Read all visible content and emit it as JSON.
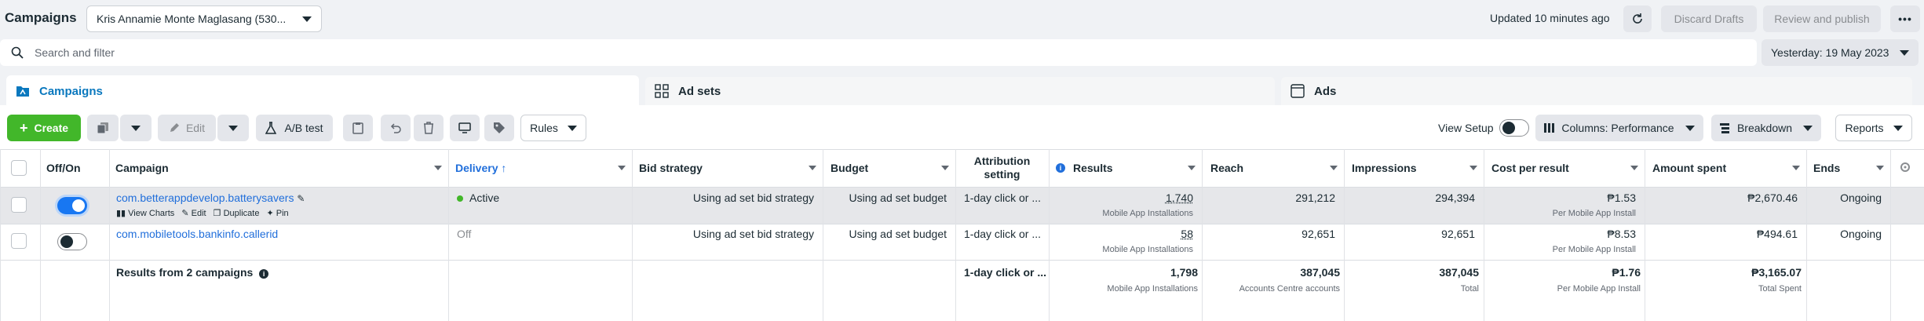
{
  "header": {
    "title": "Campaigns",
    "account": "Kris Annamie Monte Maglasang (530...",
    "updated": "Updated 10 minutes ago",
    "discard_label": "Discard Drafts",
    "review_label": "Review and publish",
    "more_label": "•••"
  },
  "search": {
    "placeholder": "Search and filter"
  },
  "date_range": "Yesterday: 19 May 2023",
  "tabs": {
    "campaigns": "Campaigns",
    "adsets": "Ad sets",
    "ads": "Ads"
  },
  "toolbar": {
    "create": "Create",
    "edit": "Edit",
    "ab_test": "A/B test",
    "rules": "Rules",
    "view_setup": "View Setup",
    "columns": "Columns: Performance",
    "breakdown": "Breakdown",
    "reports": "Reports"
  },
  "columns": {
    "offon": "Off/On",
    "campaign": "Campaign",
    "delivery": "Delivery ↑",
    "bid": "Bid strategy",
    "budget": "Budget",
    "attr1": "Attribution",
    "attr2": "setting",
    "results": "Results",
    "reach": "Reach",
    "impressions": "Impressions",
    "cpr": "Cost per result",
    "spent": "Amount spent",
    "ends": "Ends"
  },
  "rows": [
    {
      "name": "com.betterappdevelop.batterysavers",
      "actions": {
        "charts": "View Charts",
        "edit": "Edit",
        "duplicate": "Duplicate",
        "pin": "Pin"
      },
      "on": true,
      "delivery": "Active",
      "bid": "Using ad set bid strategy",
      "budget": "Using ad set budget",
      "attr": "1-day click or ...",
      "results": "1,740",
      "results_sub": "Mobile App Installations",
      "reach": "291,212",
      "impressions": "294,394",
      "cpr": "₱1.53",
      "cpr_sub": "Per Mobile App Install",
      "spent": "₱2,670.46",
      "ends": "Ongoing"
    },
    {
      "name": "com.mobiletools.bankinfo.callerid",
      "on": false,
      "delivery": "Off",
      "bid": "Using ad set bid strategy",
      "budget": "Using ad set budget",
      "attr": "1-day click or ...",
      "results": "58",
      "results_sub": "Mobile App Installations",
      "reach": "92,651",
      "impressions": "92,651",
      "cpr": "₱8.53",
      "cpr_sub": "Per Mobile App Install",
      "spent": "₱494.61",
      "ends": "Ongoing"
    }
  ],
  "totals": {
    "label": "Results from 2 campaigns",
    "attr": "1-day click or ...",
    "results": "1,798",
    "results_sub": "Mobile App Installations",
    "reach": "387,045",
    "reach_sub": "Accounts Centre accounts",
    "impressions": "387,045",
    "impressions_sub": "Total",
    "cpr": "₱1.76",
    "cpr_sub": "Per Mobile App Install",
    "spent": "₱3,165.07",
    "spent_sub": "Total Spent"
  },
  "colors": {
    "accent": "#0a78be",
    "create": "#42b72a",
    "link": "#216fdb",
    "toggle_on": "#1877f2"
  },
  "icons": [
    "search-icon",
    "refresh-icon",
    "campaign-folder-icon",
    "adsets-grid-icon",
    "ads-window-icon",
    "duplicate-icon",
    "pencil-icon",
    "flask-icon",
    "clipboard-icon",
    "undo-icon",
    "trash-icon",
    "preview-icon",
    "tag-icon",
    "columns-icon",
    "breakdown-icon",
    "info-icon",
    "bar-chart-icon",
    "pin-icon",
    "settings-icon"
  ]
}
